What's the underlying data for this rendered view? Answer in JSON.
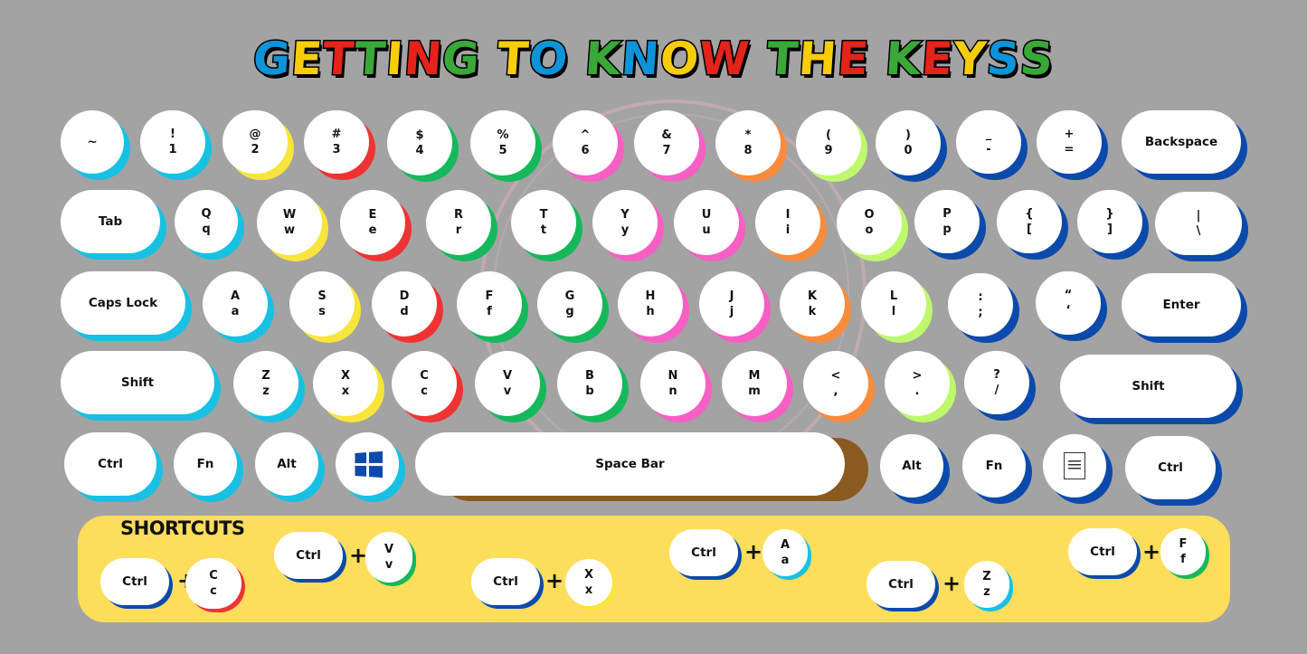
{
  "title": {
    "letters": [
      {
        "ch": "G",
        "color": "#0d93d8"
      },
      {
        "ch": "E",
        "color": "#f7cd0a"
      },
      {
        "ch": "T",
        "color": "#e4231b"
      },
      {
        "ch": "T",
        "color": "#3aa838"
      },
      {
        "ch": "I",
        "color": "#f7cd0a"
      },
      {
        "ch": "N",
        "color": "#e4231b"
      },
      {
        "ch": "G",
        "color": "#3aa838"
      },
      {
        "ch": " ",
        "color": "#000"
      },
      {
        "ch": "T",
        "color": "#f7cd0a"
      },
      {
        "ch": "O",
        "color": "#0d93d8"
      },
      {
        "ch": " ",
        "color": "#000"
      },
      {
        "ch": "K",
        "color": "#3aa838"
      },
      {
        "ch": "N",
        "color": "#0d93d8"
      },
      {
        "ch": "O",
        "color": "#f7cd0a"
      },
      {
        "ch": "W",
        "color": "#e4231b"
      },
      {
        "ch": " ",
        "color": "#000"
      },
      {
        "ch": "T",
        "color": "#3aa838"
      },
      {
        "ch": "H",
        "color": "#f7cd0a"
      },
      {
        "ch": "E",
        "color": "#e4231b"
      },
      {
        "ch": " ",
        "color": "#000"
      },
      {
        "ch": "K",
        "color": "#3aa838"
      },
      {
        "ch": "E",
        "color": "#e4231b"
      },
      {
        "ch": "Y",
        "color": "#f7cd0a"
      },
      {
        "ch": "S",
        "color": "#0d93d8"
      },
      {
        "ch": "S",
        "color": "#3aa838"
      }
    ],
    "text": "GETTING TO KNOW THE KEYS"
  },
  "colors": {
    "cyan": "#17c1e3",
    "yellow": "#f7e53b",
    "red": "#ef3333",
    "green": "#15b85a",
    "pink": "#f75fc4",
    "orange": "#f98b3c",
    "lime": "#bff86c",
    "blue": "#0b4aab",
    "brown": "#8a5a1f",
    "panel": "#fddd5c",
    "background": "#a3a3a3"
  },
  "keyboard": {
    "rows": [
      [
        {
          "id": "tilde",
          "label": "~",
          "color": "cyan"
        },
        {
          "id": "1",
          "upper": "!",
          "lower": "1",
          "color": "cyan"
        },
        {
          "id": "2",
          "upper": "@",
          "lower": "2",
          "color": "yellow"
        },
        {
          "id": "3",
          "upper": "#",
          "lower": "3",
          "color": "red"
        },
        {
          "id": "4",
          "upper": "$",
          "lower": "4",
          "color": "green"
        },
        {
          "id": "5",
          "upper": "%",
          "lower": "5",
          "color": "green"
        },
        {
          "id": "6",
          "upper": "^",
          "lower": "6",
          "color": "pink"
        },
        {
          "id": "7",
          "upper": "&",
          "lower": "7",
          "color": "pink"
        },
        {
          "id": "8",
          "upper": "*",
          "lower": "8",
          "color": "orange"
        },
        {
          "id": "9",
          "upper": "(",
          "lower": "9",
          "color": "lime"
        },
        {
          "id": "0",
          "upper": ")",
          "lower": "0",
          "color": "blue"
        },
        {
          "id": "minus",
          "upper": "_",
          "lower": "-",
          "color": "blue"
        },
        {
          "id": "equals",
          "upper": "+",
          "lower": "=",
          "color": "blue"
        },
        {
          "id": "backspace",
          "label": "Backspace",
          "color": "blue"
        }
      ],
      [
        {
          "id": "tab",
          "label": "Tab",
          "color": "cyan"
        },
        {
          "id": "q",
          "upper": "Q",
          "lower": "q",
          "color": "cyan"
        },
        {
          "id": "w",
          "upper": "W",
          "lower": "w",
          "color": "yellow"
        },
        {
          "id": "e",
          "upper": "E",
          "lower": "e",
          "color": "red"
        },
        {
          "id": "r",
          "upper": "R",
          "lower": "r",
          "color": "green"
        },
        {
          "id": "t",
          "upper": "T",
          "lower": "t",
          "color": "green"
        },
        {
          "id": "y",
          "upper": "Y",
          "lower": "y",
          "color": "pink"
        },
        {
          "id": "u",
          "upper": "U",
          "lower": "u",
          "color": "pink"
        },
        {
          "id": "i",
          "upper": "I",
          "lower": "i",
          "color": "orange"
        },
        {
          "id": "o",
          "upper": "O",
          "lower": "o",
          "color": "lime"
        },
        {
          "id": "p",
          "upper": "P",
          "lower": "p",
          "color": "blue"
        },
        {
          "id": "lbrace",
          "upper": "{",
          "lower": "[",
          "color": "blue"
        },
        {
          "id": "rbrace",
          "upper": "}",
          "lower": "]",
          "color": "blue"
        },
        {
          "id": "backslash",
          "upper": "|",
          "lower": "\\",
          "color": "blue"
        }
      ],
      [
        {
          "id": "capslock",
          "label": "Caps Lock",
          "color": "cyan"
        },
        {
          "id": "a",
          "upper": "A",
          "lower": "a",
          "color": "cyan"
        },
        {
          "id": "s",
          "upper": "S",
          "lower": "s",
          "color": "yellow"
        },
        {
          "id": "d",
          "upper": "D",
          "lower": "d",
          "color": "red"
        },
        {
          "id": "f",
          "upper": "F",
          "lower": "f",
          "color": "green"
        },
        {
          "id": "g",
          "upper": "G",
          "lower": "g",
          "color": "green"
        },
        {
          "id": "h",
          "upper": "H",
          "lower": "h",
          "color": "pink"
        },
        {
          "id": "j",
          "upper": "J",
          "lower": "j",
          "color": "pink"
        },
        {
          "id": "k",
          "upper": "K",
          "lower": "k",
          "color": "orange"
        },
        {
          "id": "l",
          "upper": "L",
          "lower": "l",
          "color": "lime"
        },
        {
          "id": "semicolon",
          "upper": ":",
          "lower": ";",
          "color": "blue"
        },
        {
          "id": "quote",
          "upper": "“",
          "lower": "‘",
          "color": "blue"
        },
        {
          "id": "enter",
          "label": "Enter",
          "color": "blue"
        }
      ],
      [
        {
          "id": "shift-left",
          "label": "Shift",
          "color": "cyan"
        },
        {
          "id": "z",
          "upper": "Z",
          "lower": "z",
          "color": "cyan"
        },
        {
          "id": "x",
          "upper": "X",
          "lower": "x",
          "color": "yellow"
        },
        {
          "id": "c",
          "upper": "C",
          "lower": "c",
          "color": "red"
        },
        {
          "id": "v",
          "upper": "V",
          "lower": "v",
          "color": "green"
        },
        {
          "id": "b",
          "upper": "B",
          "lower": "b",
          "color": "green"
        },
        {
          "id": "n",
          "upper": "N",
          "lower": "n",
          "color": "pink"
        },
        {
          "id": "m",
          "upper": "M",
          "lower": "m",
          "color": "pink"
        },
        {
          "id": "comma",
          "upper": "<",
          "lower": ",",
          "color": "orange"
        },
        {
          "id": "period",
          "upper": ">",
          "lower": ".",
          "color": "lime"
        },
        {
          "id": "slash",
          "upper": "?",
          "lower": "/",
          "color": "blue"
        },
        {
          "id": "shift-right",
          "label": "Shift",
          "color": "blue"
        }
      ],
      [
        {
          "id": "ctrl-left",
          "label": "Ctrl",
          "color": "cyan"
        },
        {
          "id": "fn-left",
          "label": "Fn",
          "color": "cyan"
        },
        {
          "id": "alt-left",
          "label": "Alt",
          "color": "cyan"
        },
        {
          "id": "windows",
          "icon": "windows-logo-icon",
          "color": "cyan"
        },
        {
          "id": "space",
          "label": "Space Bar",
          "color": "brown"
        },
        {
          "id": "alt-right",
          "label": "Alt",
          "color": "blue"
        },
        {
          "id": "fn-right",
          "label": "Fn",
          "color": "blue"
        },
        {
          "id": "menu",
          "icon": "document-menu-icon",
          "color": "blue"
        },
        {
          "id": "ctrl-right",
          "label": "Ctrl",
          "color": "blue"
        }
      ]
    ]
  },
  "shortcuts": {
    "title": "SHORTCUTS",
    "plus": "+",
    "items": [
      {
        "modifier": "Ctrl",
        "upper": "C",
        "lower": "c",
        "color": "red"
      },
      {
        "modifier": "Ctrl",
        "upper": "V",
        "lower": "v",
        "color": "green"
      },
      {
        "modifier": "Ctrl",
        "upper": "X",
        "lower": "x",
        "color": "yellow"
      },
      {
        "modifier": "Ctrl",
        "upper": "A",
        "lower": "a",
        "color": "cyan"
      },
      {
        "modifier": "Ctrl",
        "upper": "Z",
        "lower": "z",
        "color": "cyan"
      },
      {
        "modifier": "Ctrl",
        "upper": "F",
        "lower": "f",
        "color": "green"
      }
    ]
  }
}
